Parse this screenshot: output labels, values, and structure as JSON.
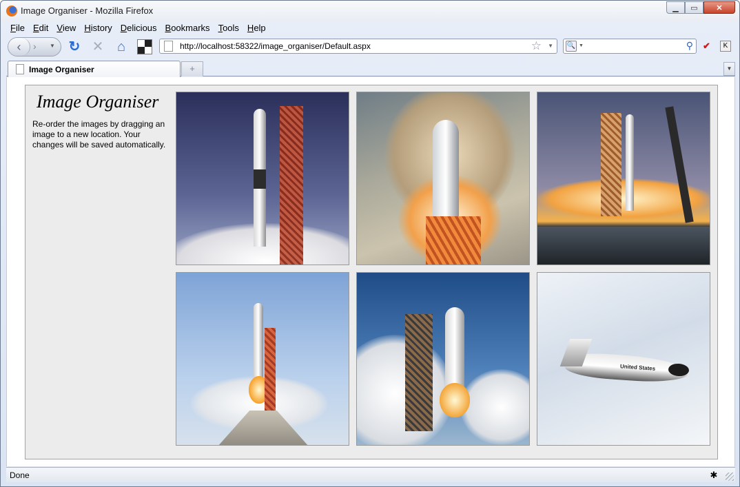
{
  "window": {
    "title": "Image Organiser - Mozilla Firefox"
  },
  "menu": [
    "File",
    "Edit",
    "View",
    "History",
    "Delicious",
    "Bookmarks",
    "Tools",
    "Help"
  ],
  "urlbar": {
    "url": "http://localhost:58322/image_organiser/Default.aspx"
  },
  "tab": {
    "label": "Image Organiser"
  },
  "page": {
    "heading": "Image Organiser",
    "instructions": "Re-order the images by dragging an image to a new location. Your changes will be saved automatically."
  },
  "images": [
    {
      "subject": "rocket-on-launch-pad",
      "text": ""
    },
    {
      "subject": "rocket-liftoff-from-above",
      "text": ""
    },
    {
      "subject": "launch-tower-at-dusk",
      "text": ""
    },
    {
      "subject": "rocket-launch-blue-sky",
      "text": ""
    },
    {
      "subject": "space-shuttle-liftoff",
      "text": ""
    },
    {
      "subject": "lifting-body-aircraft-in-flight",
      "text": "United States"
    }
  ],
  "status": {
    "text": "Done"
  },
  "icons": {
    "back": "back-arrow-icon",
    "forward": "forward-arrow-icon",
    "reload": "reload-icon",
    "stop": "stop-icon",
    "home": "home-icon",
    "bookmark_star": "star-icon",
    "search": "search-icon"
  }
}
